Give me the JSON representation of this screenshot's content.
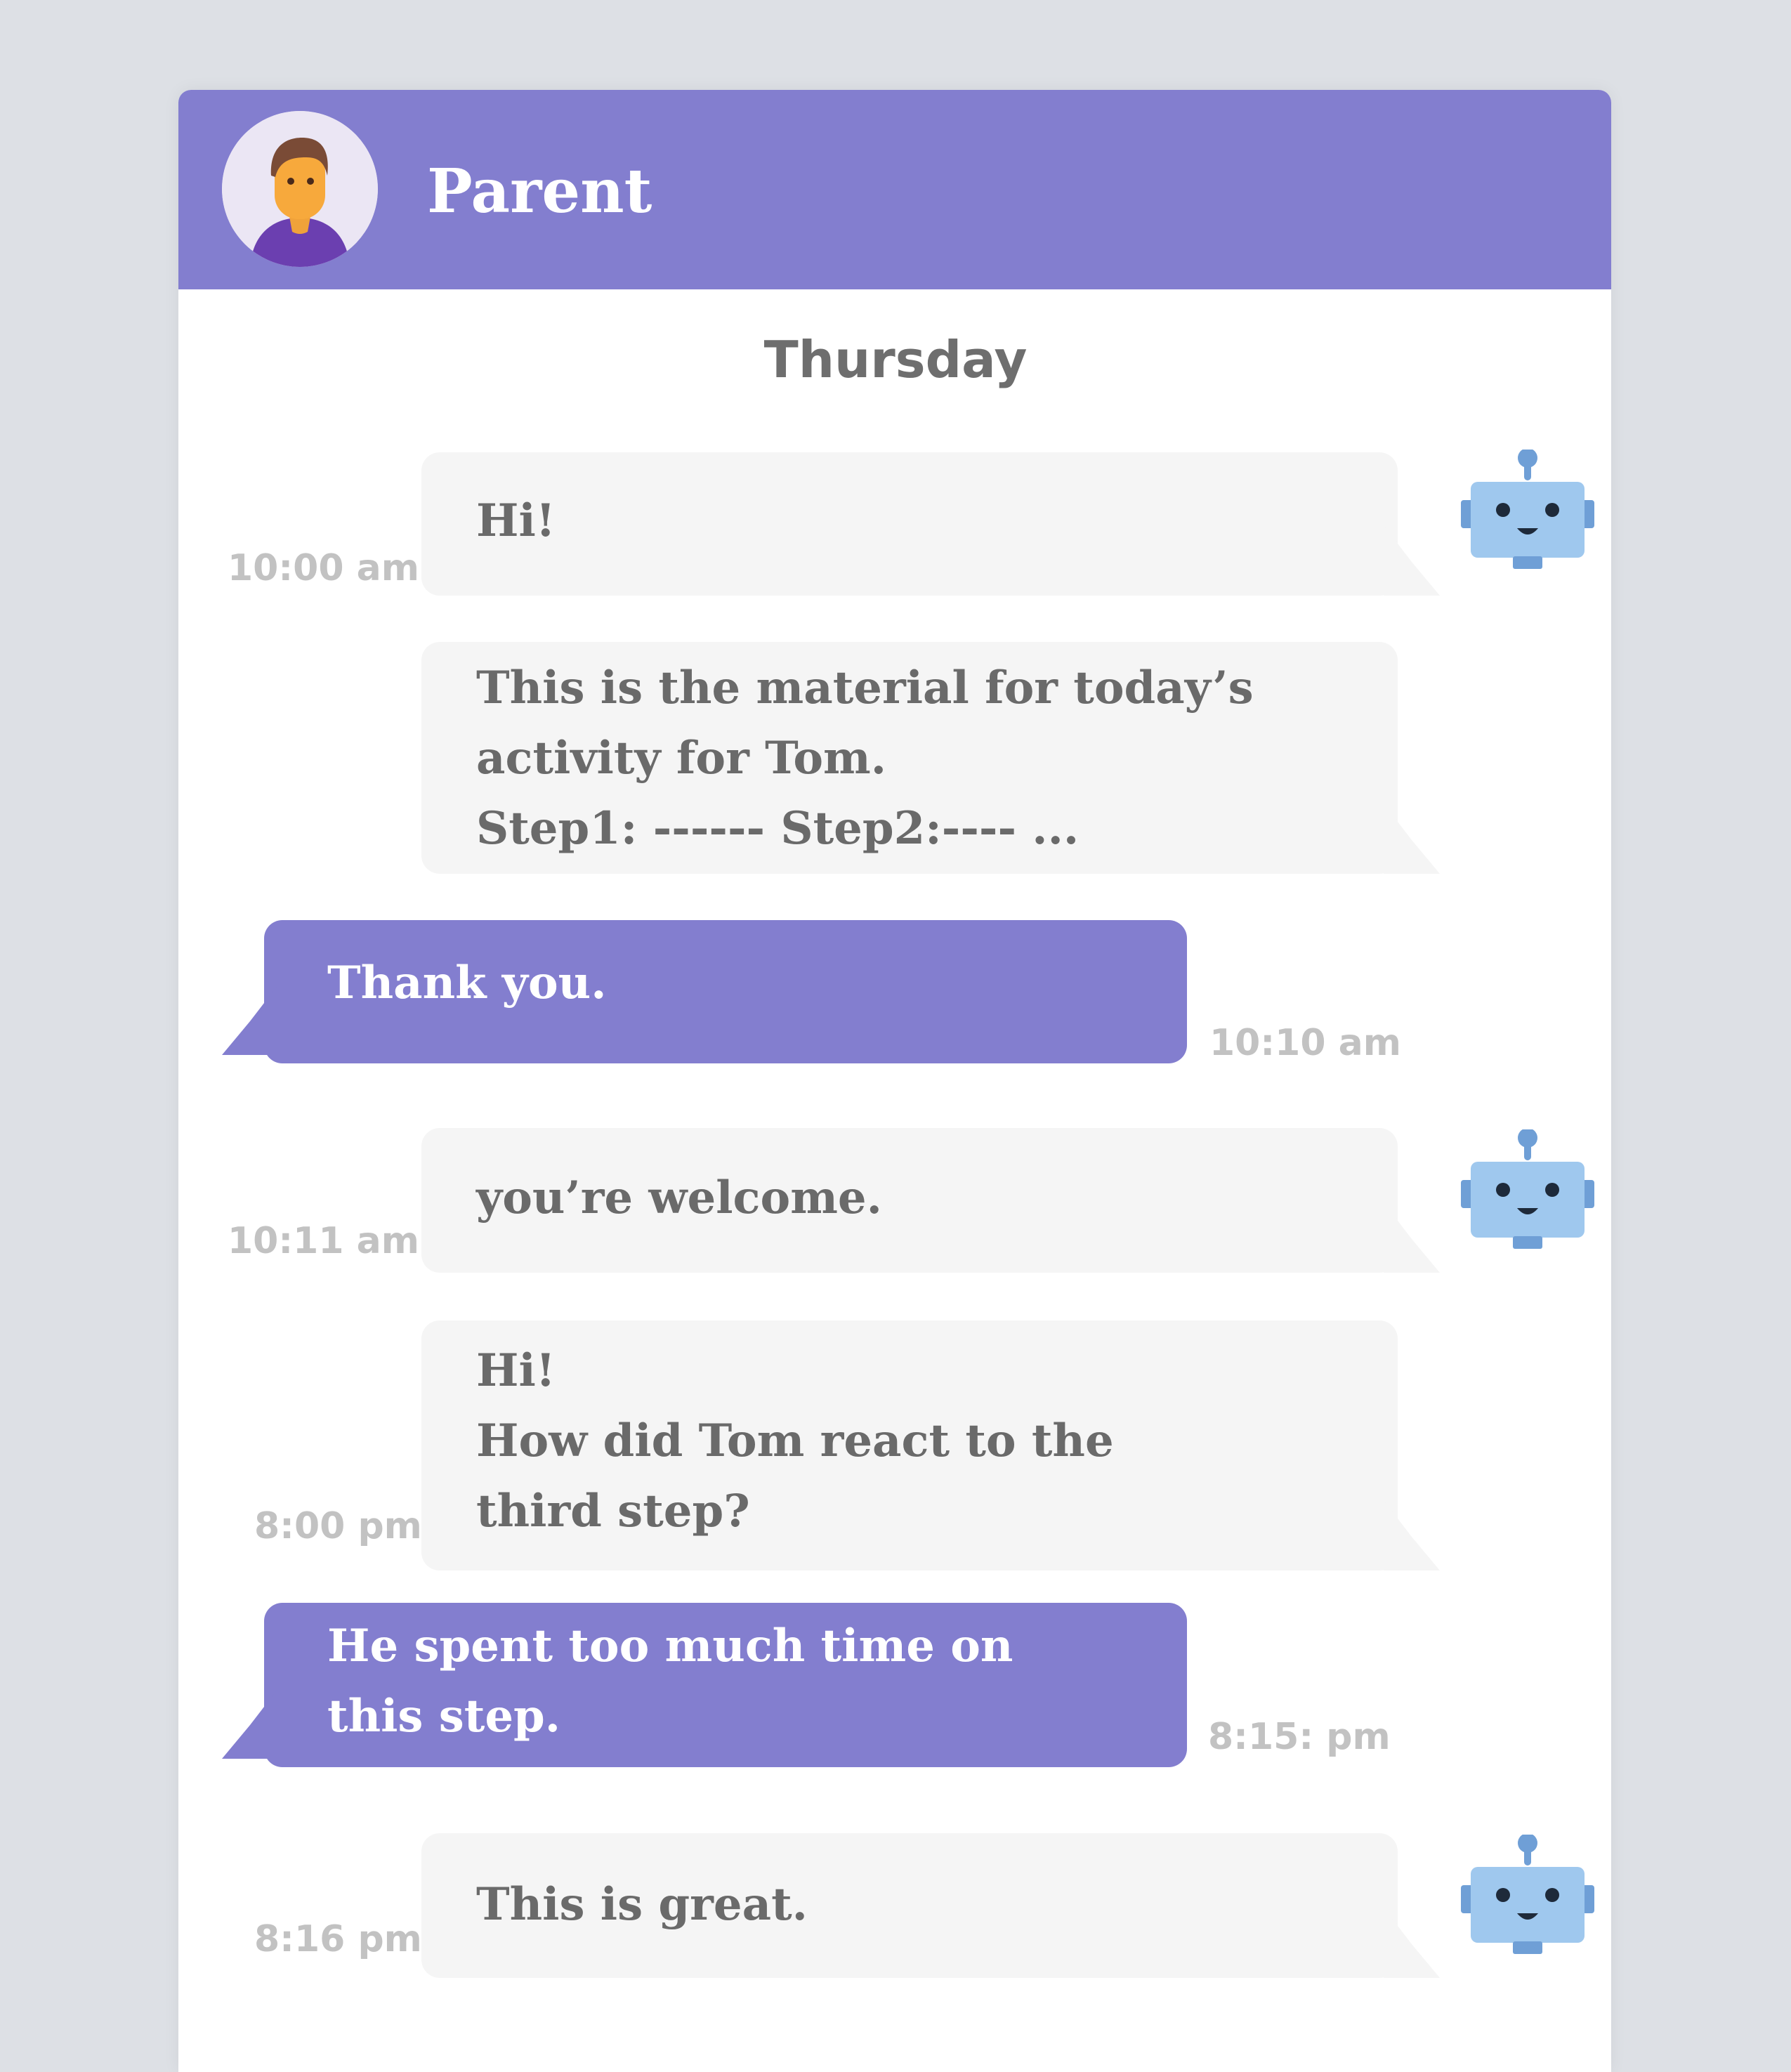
{
  "header": {
    "contact_name": "Parent",
    "avatar_icon": "person-avatar-icon"
  },
  "conversation": {
    "day_label": "Thursday",
    "messages": [
      {
        "sender": "bot",
        "text": "Hi!",
        "time": "10:00 am"
      },
      {
        "sender": "bot",
        "text": "This is the material for today’s\nactivity for Tom.\nStep1: ------      Step2:----  ...",
        "time": ""
      },
      {
        "sender": "parent",
        "text": "Thank you.",
        "time": "10:10 am"
      },
      {
        "sender": "bot",
        "text": "you’re welcome.",
        "time": "10:11 am"
      },
      {
        "sender": "bot",
        "text": "Hi!\nHow did Tom react to the\nthird step?",
        "time": "8:00 pm"
      },
      {
        "sender": "parent",
        "text": "He spent too much time on\nthis step.",
        "time": "8:15: pm"
      },
      {
        "sender": "bot",
        "text": "This is great.",
        "time": "8:16 pm"
      }
    ]
  },
  "icons": {
    "bot": "robot-icon"
  },
  "colors": {
    "accent": "#837ecf",
    "incoming_bubble": "#f5f5f5",
    "incoming_text": "#6a6a6a",
    "timestamp": "#c2c2c2",
    "page_background": "#dde0e5"
  }
}
